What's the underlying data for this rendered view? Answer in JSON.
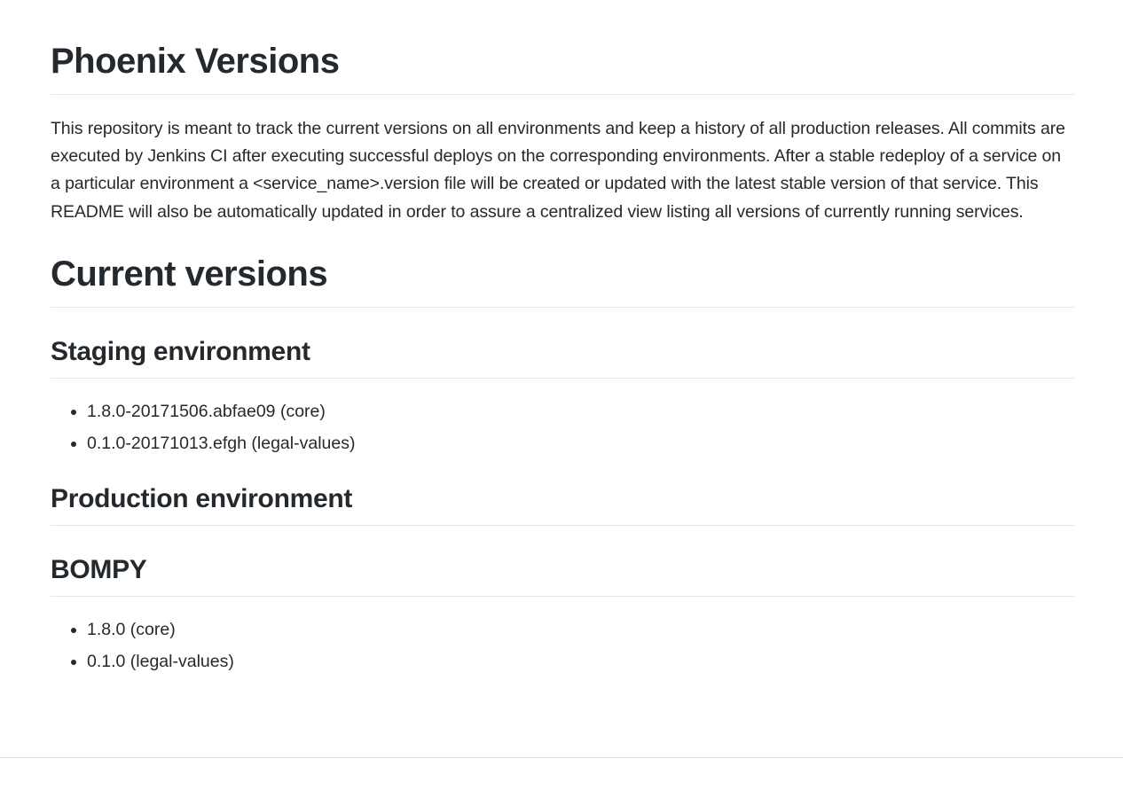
{
  "readme": {
    "title": "Phoenix Versions",
    "intro": "This repository is meant to track the current versions on all environments and keep a history of all production releases. All commits are executed by Jenkins CI after executing successful deploys on the corresponding environments. After a stable redeploy of a service on a particular environment a <service_name>.version file will be created or updated with the latest stable version of that service. This README will also be automatically updated in order to assure a centralized view listing all versions of currently running services.",
    "current_heading": "Current versions",
    "staging": {
      "heading": "Staging environment",
      "items": [
        "1.8.0-20171506.abfae09 (core)",
        "0.1.0-20171013.efgh (legal-values)"
      ]
    },
    "production": {
      "heading": "Production environment"
    },
    "bompy": {
      "heading": "BOMPY",
      "items": [
        "1.8.0 (core)",
        "0.1.0 (legal-values)"
      ]
    }
  }
}
